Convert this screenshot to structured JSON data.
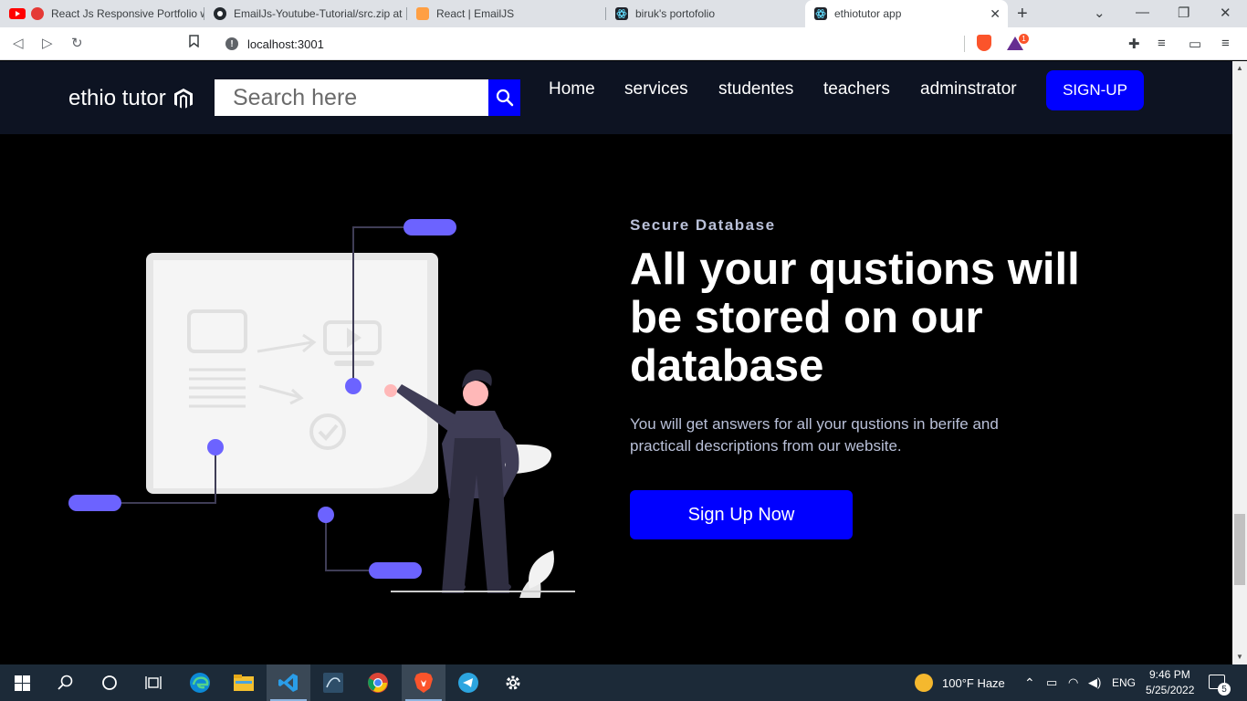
{
  "browser": {
    "tabs": [
      {
        "title": "React Js Responsive Portfolio w",
        "icon": "youtube-icon"
      },
      {
        "title": "EmailJs-Youtube-Tutorial/src.zip at",
        "icon": "github-icon"
      },
      {
        "title": "React | EmailJS",
        "icon": "emailjs-icon"
      },
      {
        "title": "biruk's portofolio",
        "icon": "react-icon"
      },
      {
        "title": "ethiotutor app",
        "icon": "react-icon",
        "active": true
      }
    ],
    "url": "localhost:3001",
    "rewards_badge": "1"
  },
  "site": {
    "brand": "ethio tutor",
    "search_placeholder": "Search here",
    "nav": [
      "Home",
      "services",
      "studentes",
      "teachers",
      "adminstrator"
    ],
    "signup_label": "SIGN-UP"
  },
  "hero": {
    "eyebrow": "Secure Database",
    "headline": "All your qustions will be stored on our database",
    "description": "You will get answers for all your qustions in berife and practicall descriptions from our website.",
    "cta_label": "Sign Up Now"
  },
  "colors": {
    "accent": "#0000ff",
    "illustration_purple": "#6c63ff",
    "nav_bg": "#0d1322"
  },
  "taskbar": {
    "weather": "100°F  Haze",
    "language": "ENG",
    "time": "9:46 PM",
    "date": "5/25/2022",
    "notifications": "5"
  }
}
